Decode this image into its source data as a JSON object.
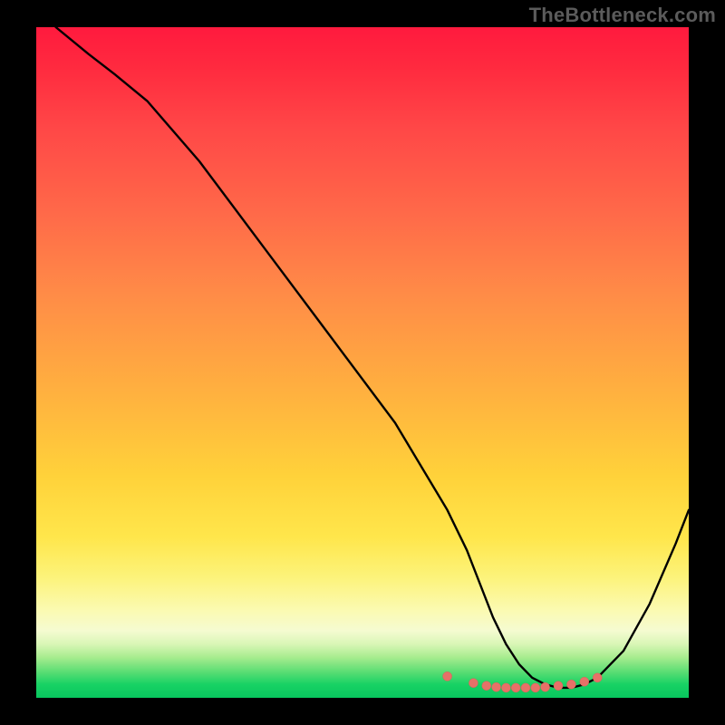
{
  "watermark": "TheBottleneck.com",
  "chart_data": {
    "type": "line",
    "title": "",
    "xlabel": "",
    "ylabel": "",
    "xlim": [
      0,
      100
    ],
    "ylim": [
      0,
      100
    ],
    "series": [
      {
        "name": "curve",
        "x": [
          3,
          8,
          12,
          17,
          25,
          35,
          45,
          55,
          63,
          66,
          68,
          70,
          72,
          74,
          76,
          78,
          80,
          82,
          84,
          86,
          90,
          94,
          98,
          100
        ],
        "y": [
          100,
          96,
          93,
          89,
          80,
          67,
          54,
          41,
          28,
          22,
          17,
          12,
          8,
          5,
          3,
          2,
          1.5,
          1.5,
          2,
          3,
          7,
          14,
          23,
          28
        ]
      }
    ],
    "markers": {
      "name": "highlight-dots",
      "x": [
        63,
        67,
        69,
        70.5,
        72,
        73.5,
        75,
        76.5,
        78,
        80,
        82,
        84,
        86
      ],
      "y": [
        3.2,
        2.2,
        1.8,
        1.6,
        1.5,
        1.5,
        1.5,
        1.5,
        1.6,
        1.8,
        2.0,
        2.4,
        3.0
      ]
    },
    "gradient_stops": [
      {
        "pos": 0,
        "color": "#ff1a3e"
      },
      {
        "pos": 28,
        "color": "#ff6a49"
      },
      {
        "pos": 55,
        "color": "#ffb23f"
      },
      {
        "pos": 76,
        "color": "#ffe64b"
      },
      {
        "pos": 90,
        "color": "#f5fbd1"
      },
      {
        "pos": 100,
        "color": "#08c65e"
      }
    ]
  }
}
